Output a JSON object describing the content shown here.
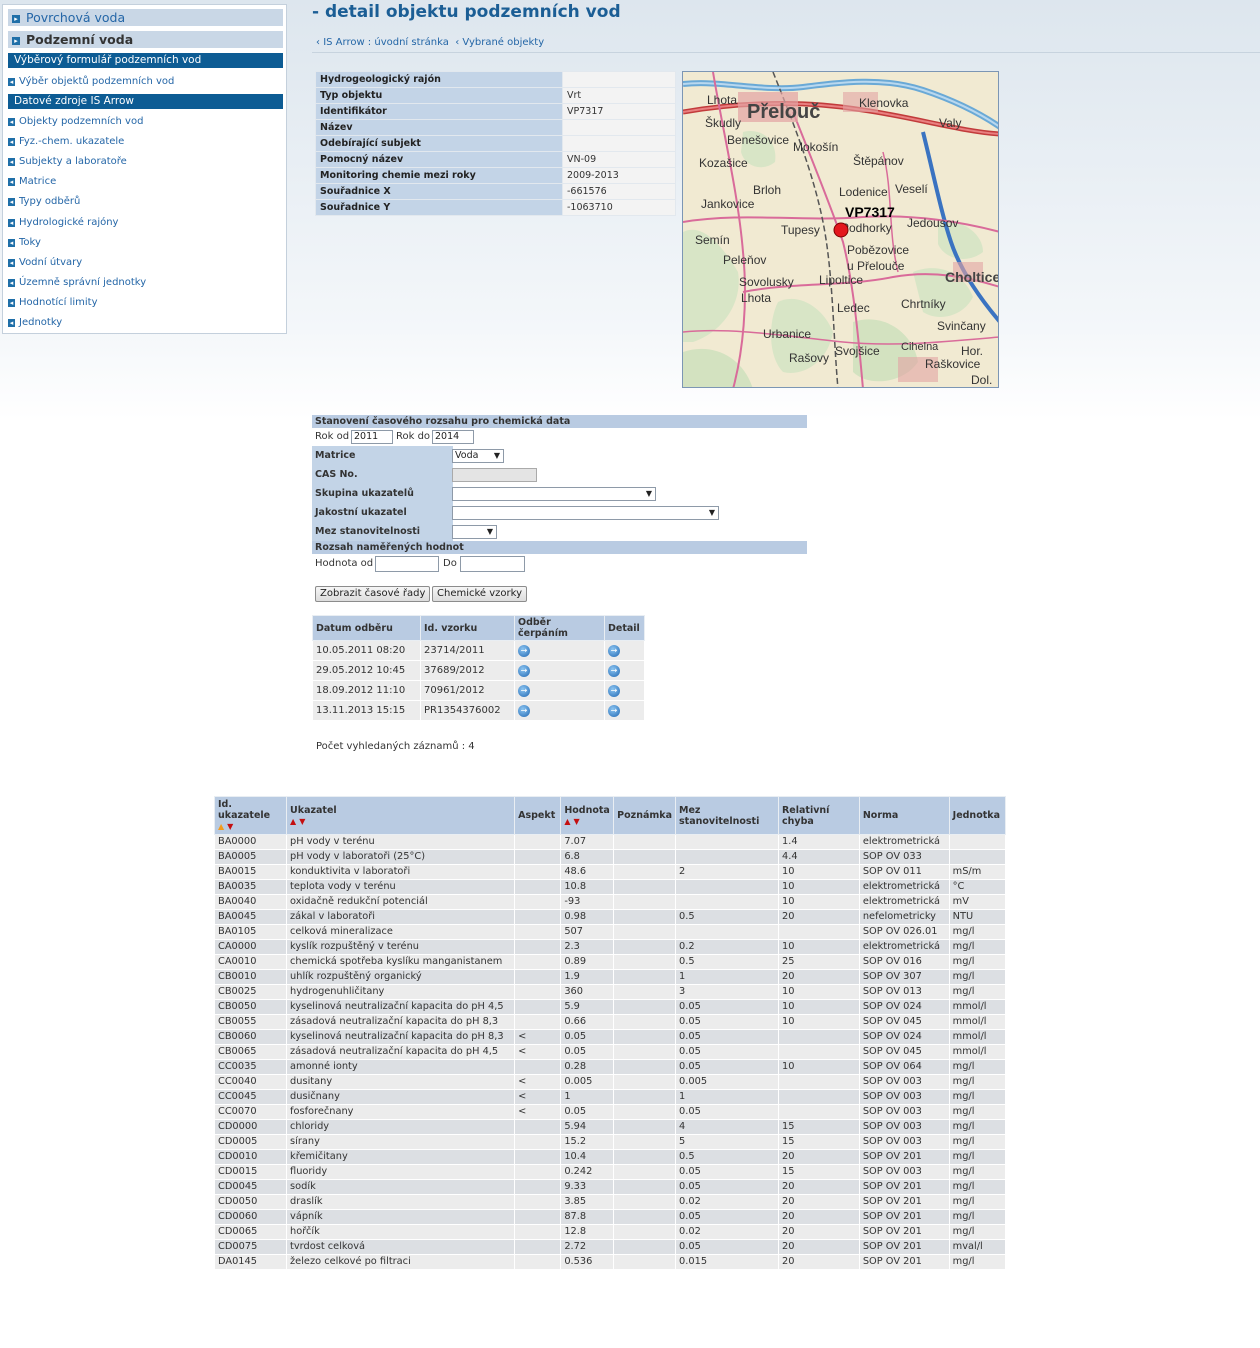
{
  "sidebar": {
    "top1": "Povrchová voda",
    "top2": "Podzemní voda",
    "head1": "Výběrový formulář podzemních vod",
    "link1": "Výběr objektů podzemních vod",
    "head2": "Datové zdroje IS Arrow",
    "items": [
      "Objekty podzemních vod",
      "Fyz.-chem. ukazatele",
      "Subjekty a laboratoře",
      "Matrice",
      "Typy odběrů",
      "Hydrologické rajóny",
      "Toky",
      "Vodní útvary",
      "Územně správní jednotky",
      "Hodnotící limity",
      "Jednotky"
    ]
  },
  "page": {
    "title": "- detail objektu podzemních vod",
    "crumb1": "IS Arrow : úvodní stránka",
    "crumb2": "Vybrané objekty"
  },
  "info": [
    {
      "label": "Hydrogeologický rajón",
      "value": ""
    },
    {
      "label": "Typ objektu",
      "value": "Vrt"
    },
    {
      "label": "Identifikátor",
      "value": "VP7317"
    },
    {
      "label": "Název",
      "value": ""
    },
    {
      "label": "Odebírající subjekt",
      "value": ""
    },
    {
      "label": "Pomocný název",
      "value": "VN-09"
    },
    {
      "label": "Monitoring chemie mezi roky",
      "value": "2009-2013"
    },
    {
      "label": "Souřadnice X",
      "value": "-661576"
    },
    {
      "label": "Souřadnice Y",
      "value": "-1063710"
    }
  ],
  "map": {
    "marker_label": "VP7317",
    "places": [
      "Přelouč",
      "Lhota",
      "Klenovka",
      "Škudly",
      "Valy",
      "Benešovice",
      "Mokošín",
      "Kozašice",
      "Štěpánov",
      "Brloh",
      "Lodenice",
      "Veselí",
      "Jankovice",
      "Podhorky",
      "Jedousov",
      "Semín",
      "Tupesy",
      "Pobězovice u Přelouče",
      "Peleňov",
      "Sovolusky",
      "Choltice",
      "Lhota",
      "Lipoltice",
      "Chrtníky",
      "Ledec",
      "Svinčany",
      "Urbanice",
      "Rašovy",
      "Svojšice",
      "Cihelna",
      "Raškovice",
      "Hor.",
      "Dol."
    ]
  },
  "form": {
    "hdr1": "Stanovení časového rozsahu pro chemická data",
    "rok_od_label": "Rok od",
    "rok_od": "2011",
    "rok_do_label": "Rok do",
    "rok_do": "2014",
    "matrice_label": "Matrice",
    "matrice": "Voda",
    "cas_label": "CAS No.",
    "skupina_label": "Skupina ukazatelů",
    "jakost_label": "Jakostní ukazatel",
    "mez_label": "Mez stanovitelnosti",
    "hdr2": "Rozsah naměřených hodnot",
    "hod_od_label": "Hodnota od",
    "hod_do_label": "Do",
    "btn1": "Zobrazit časové řady",
    "btn2": "Chemické vzorky"
  },
  "samples": {
    "headers": [
      "Datum odběru",
      "Id. vzorku",
      "Odběr čerpáním",
      "Detail"
    ],
    "rows": [
      [
        "10.05.2011 08:20",
        "23714/2011"
      ],
      [
        "29.05.2012 10:45",
        "37689/2012"
      ],
      [
        "18.09.2012 11:10",
        "70961/2012"
      ],
      [
        "13.11.2013 15:15",
        "PR1354376002"
      ]
    ],
    "count": "Počet vyhledaných záznamů : 4"
  },
  "results": {
    "headers": [
      "Id. ukazatele",
      "Ukazatel",
      "Aspekt",
      "Hodnota",
      "Poznámka",
      "Mez stanovitelnosti",
      "Relativní chyba",
      "Norma",
      "Jednotka"
    ],
    "rows": [
      [
        "BA0000",
        "pH vody v terénu",
        "",
        "7.07",
        "",
        "",
        "1.4",
        "elektrometrická",
        ""
      ],
      [
        "BA0005",
        "pH vody v laboratoři (25°C)",
        "",
        "6.8",
        "",
        "",
        "4.4",
        "SOP OV 033",
        ""
      ],
      [
        "BA0015",
        "konduktivita v laboratoři",
        "",
        "48.6",
        "",
        "2",
        "10",
        "SOP OV 011",
        "mS/m"
      ],
      [
        "BA0035",
        "teplota vody v terénu",
        "",
        "10.8",
        "",
        "",
        "10",
        "elektrometrická",
        "°C"
      ],
      [
        "BA0040",
        "oxidačně redukční potenciál",
        "",
        "-93",
        "",
        "",
        "10",
        "elektrometrická",
        "mV"
      ],
      [
        "BA0045",
        "zákal v laboratoři",
        "",
        "0.98",
        "",
        "0.5",
        "20",
        "nefelometricky",
        "NTU"
      ],
      [
        "BA0105",
        "celková mineralizace",
        "",
        "507",
        "",
        "",
        "",
        "SOP OV 026.01",
        "mg/l"
      ],
      [
        "CA0000",
        "kyslík rozpuštěný v terénu",
        "",
        "2.3",
        "",
        "0.2",
        "10",
        "elektrometrická",
        "mg/l"
      ],
      [
        "CA0010",
        "chemická spotřeba kyslíku manganistanem",
        "",
        "0.89",
        "",
        "0.5",
        "25",
        "SOP OV 016",
        "mg/l"
      ],
      [
        "CB0010",
        "uhlík rozpuštěný organický",
        "",
        "1.9",
        "",
        "1",
        "20",
        "SOP OV 307",
        "mg/l"
      ],
      [
        "CB0025",
        "hydrogenuhličitany",
        "",
        "360",
        "",
        "3",
        "10",
        "SOP OV 013",
        "mg/l"
      ],
      [
        "CB0050",
        "kyselinová neutralizační kapacita do pH 4,5",
        "",
        "5.9",
        "",
        "0.05",
        "10",
        "SOP OV 024",
        "mmol/l"
      ],
      [
        "CB0055",
        "zásadová neutralizační kapacita do pH 8,3",
        "",
        "0.66",
        "",
        "0.05",
        "10",
        "SOP OV 045",
        "mmol/l"
      ],
      [
        "CB0060",
        "kyselinová neutralizační kapacita do pH 8,3",
        "<",
        "0.05",
        "",
        "0.05",
        "",
        "SOP OV 024",
        "mmol/l"
      ],
      [
        "CB0065",
        "zásadová neutralizační kapacita do pH 4,5",
        "<",
        "0.05",
        "",
        "0.05",
        "",
        "SOP OV 045",
        "mmol/l"
      ],
      [
        "CC0035",
        "amonné ionty",
        "",
        "0.28",
        "",
        "0.05",
        "10",
        "SOP OV 064",
        "mg/l"
      ],
      [
        "CC0040",
        "dusitany",
        "<",
        "0.005",
        "",
        "0.005",
        "",
        "SOP OV 003",
        "mg/l"
      ],
      [
        "CC0045",
        "dusičnany",
        "<",
        "1",
        "",
        "1",
        "",
        "SOP OV 003",
        "mg/l"
      ],
      [
        "CC0070",
        "fosforečnany",
        "<",
        "0.05",
        "",
        "0.05",
        "",
        "SOP OV 003",
        "mg/l"
      ],
      [
        "CD0000",
        "chloridy",
        "",
        "5.94",
        "",
        "4",
        "15",
        "SOP OV 003",
        "mg/l"
      ],
      [
        "CD0005",
        "sírany",
        "",
        "15.2",
        "",
        "5",
        "15",
        "SOP OV 003",
        "mg/l"
      ],
      [
        "CD0010",
        "křemičitany",
        "",
        "10.4",
        "",
        "0.5",
        "20",
        "SOP OV 201",
        "mg/l"
      ],
      [
        "CD0015",
        "fluoridy",
        "",
        "0.242",
        "",
        "0.05",
        "15",
        "SOP OV 003",
        "mg/l"
      ],
      [
        "CD0045",
        "sodík",
        "",
        "9.33",
        "",
        "0.05",
        "20",
        "SOP OV 201",
        "mg/l"
      ],
      [
        "CD0050",
        "draslík",
        "",
        "3.85",
        "",
        "0.02",
        "20",
        "SOP OV 201",
        "mg/l"
      ],
      [
        "CD0060",
        "vápník",
        "",
        "87.8",
        "",
        "0.05",
        "20",
        "SOP OV 201",
        "mg/l"
      ],
      [
        "CD0065",
        "hořčík",
        "",
        "12.8",
        "",
        "0.02",
        "20",
        "SOP OV 201",
        "mg/l"
      ],
      [
        "CD0075",
        "tvrdost celková",
        "",
        "2.72",
        "",
        "0.05",
        "20",
        "SOP OV 201",
        "mval/l"
      ],
      [
        "DA0145",
        "železo celkové po filtraci",
        "",
        "0.536",
        "",
        "0.015",
        "20",
        "SOP OV 201",
        "mg/l"
      ]
    ]
  }
}
